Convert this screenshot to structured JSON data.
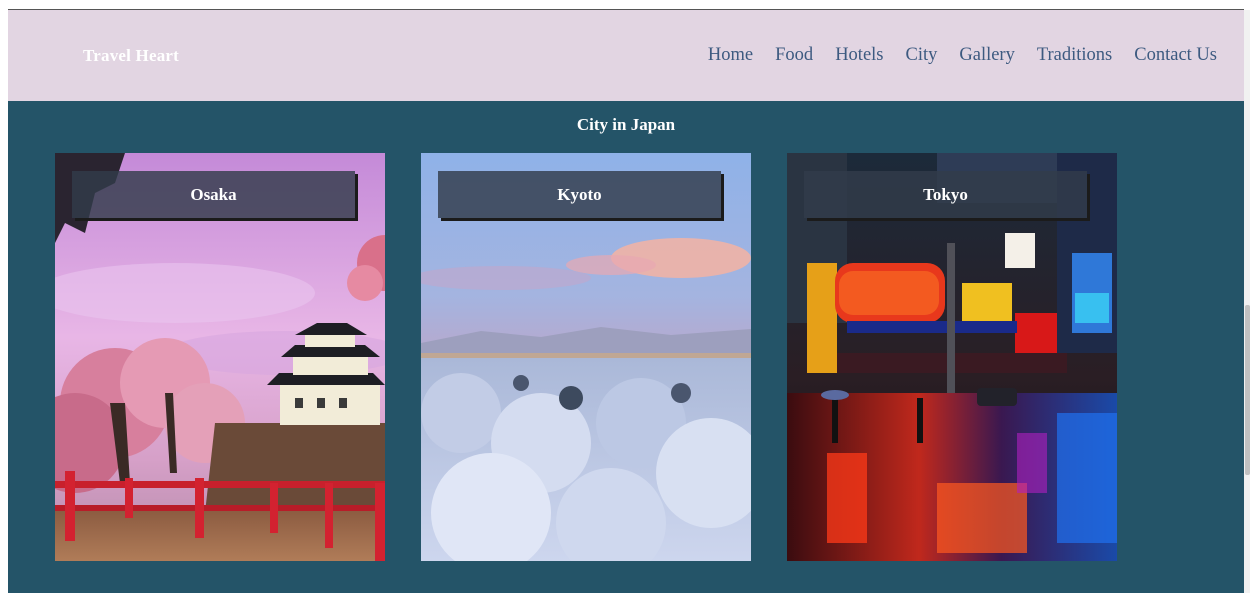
{
  "header": {
    "brand": "Travel Heart",
    "nav": [
      "Home",
      "Food",
      "Hotels",
      "City",
      "Gallery",
      "Traditions",
      "Contact Us"
    ]
  },
  "section": {
    "title": "City in Japan",
    "cards": [
      {
        "label": "Osaka",
        "image": "osaka-castle-cherry-blossoms-photo"
      },
      {
        "label": "Kyoto",
        "image": "kyoto-snowy-city-photo"
      },
      {
        "label": "Tokyo",
        "image": "tokyo-neon-street-night-photo"
      }
    ]
  },
  "colors": {
    "navbar_bg": "#e2d5e2",
    "nav_link": "#3d5a80",
    "section_bg": "#245468",
    "label_bg": "#323c4b"
  }
}
